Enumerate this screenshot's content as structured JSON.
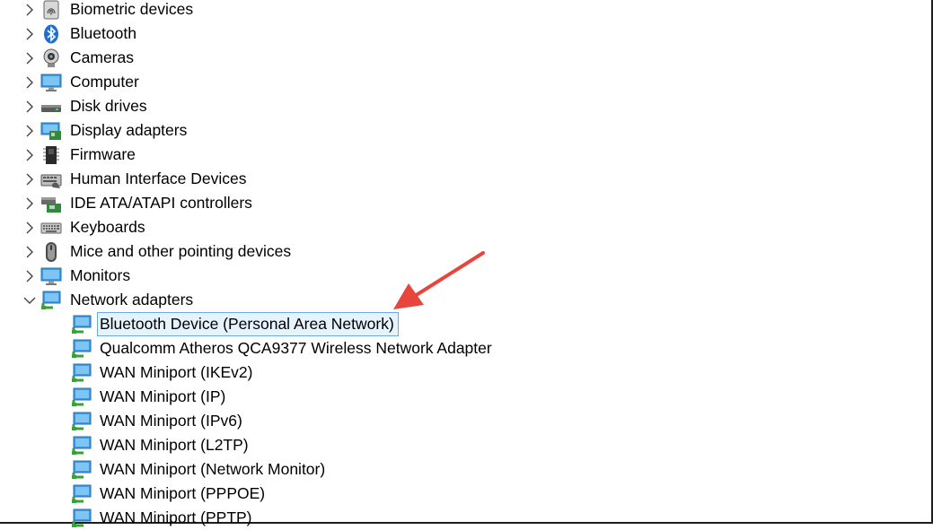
{
  "categories": [
    {
      "label": "Biometric devices",
      "icon": "fingerprint-icon",
      "expanded": false
    },
    {
      "label": "Bluetooth",
      "icon": "bluetooth-icon",
      "expanded": false
    },
    {
      "label": "Cameras",
      "icon": "webcam-icon",
      "expanded": false
    },
    {
      "label": "Computer",
      "icon": "monitor-icon",
      "expanded": false
    },
    {
      "label": "Disk drives",
      "icon": "disk-drive-icon",
      "expanded": false
    },
    {
      "label": "Display adapters",
      "icon": "display-adapter-icon",
      "expanded": false
    },
    {
      "label": "Firmware",
      "icon": "chip-icon",
      "expanded": false
    },
    {
      "label": "Human Interface Devices",
      "icon": "hid-icon",
      "expanded": false
    },
    {
      "label": "IDE ATA/ATAPI controllers",
      "icon": "ide-controller-icon",
      "expanded": false
    },
    {
      "label": "Keyboards",
      "icon": "keyboard-icon",
      "expanded": false
    },
    {
      "label": "Mice and other pointing devices",
      "icon": "mouse-icon",
      "expanded": false
    },
    {
      "label": "Monitors",
      "icon": "monitor-icon",
      "expanded": false
    },
    {
      "label": "Network adapters",
      "icon": "network-adapter-icon",
      "expanded": true
    }
  ],
  "network_adapters": [
    {
      "label": "Bluetooth Device (Personal Area Network)",
      "selected": true
    },
    {
      "label": "Qualcomm Atheros QCA9377 Wireless Network Adapter",
      "selected": false
    },
    {
      "label": "WAN Miniport (IKEv2)",
      "selected": false
    },
    {
      "label": "WAN Miniport (IP)",
      "selected": false
    },
    {
      "label": "WAN Miniport (IPv6)",
      "selected": false
    },
    {
      "label": "WAN Miniport (L2TP)",
      "selected": false
    },
    {
      "label": "WAN Miniport (Network Monitor)",
      "selected": false
    },
    {
      "label": "WAN Miniport (PPPOE)",
      "selected": false
    },
    {
      "label": "WAN Miniport (PPTP)",
      "selected": false
    }
  ],
  "colors": {
    "selection_bg": "#e5f3ff",
    "selection_border": "#6ba9e8",
    "annotation_arrow": "#e8453c",
    "icon_blue": "#2b88d8"
  }
}
